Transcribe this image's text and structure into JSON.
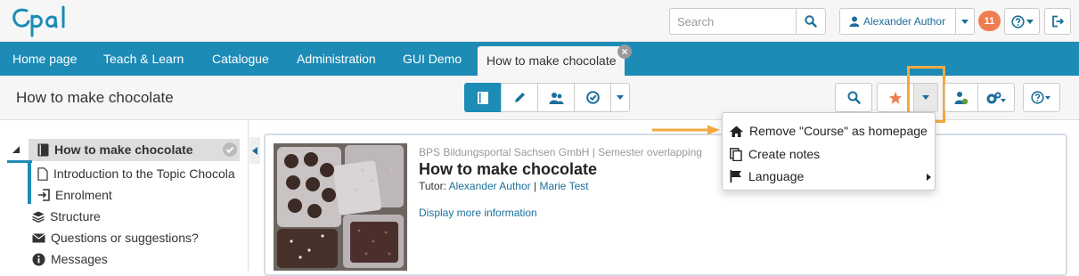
{
  "colors": {
    "brand": "#1c8bb6",
    "accent": "#f4a83f",
    "badge": "#f07d4f"
  },
  "header": {
    "logo_text": "Opal",
    "search": {
      "placeholder": "Search",
      "value": ""
    },
    "user_name": "Alexander Author",
    "notification_count": "11"
  },
  "nav": {
    "items": [
      {
        "label": "Home page",
        "icon": "none"
      },
      {
        "label": "Teach & Learn",
        "icon": "none"
      },
      {
        "label": "Catalogue",
        "icon": "none"
      },
      {
        "label": "Administration",
        "icon": "none"
      },
      {
        "label": "GUI Demo",
        "icon": "none"
      }
    ],
    "active_tab": {
      "label": "How to make chocolate",
      "close_icon": "close-icon"
    }
  },
  "toolbar": {
    "title": "How to make chocolate",
    "center_tools": [
      "book-icon",
      "pencil-icon",
      "users-icon",
      "check-circle-icon",
      "caret-down-icon"
    ],
    "right_tools": [
      "search-icon",
      "star-icon",
      "caret-down-icon",
      "user-settings-icon",
      "gears-icon",
      "help-icon"
    ]
  },
  "tree": {
    "root": {
      "label": "How to make chocolate",
      "icon": "book-icon",
      "status_icon": "check-icon"
    },
    "children": [
      {
        "label": "Introduction to the Topic Chocola",
        "icon": "page-icon"
      },
      {
        "label": "Enrolment",
        "icon": "enrol-icon"
      }
    ],
    "extras": [
      {
        "label": "Structure",
        "icon": "layers-icon"
      },
      {
        "label": "Questions or suggestions?",
        "icon": "envelope-icon"
      },
      {
        "label": "Messages",
        "icon": "info-icon"
      }
    ]
  },
  "course": {
    "meta": "BPS Bildungsportal Sachsen GmbH | Semester overlapping",
    "title": "How to make chocolate",
    "tutor_label": "Tutor:",
    "tutors": [
      "Alexander Author",
      "Marie Test"
    ],
    "separator": "|",
    "more_info": "Display more information"
  },
  "dropdown": {
    "items": [
      {
        "label": "Remove \"Course\" as homepage",
        "icon": "home-icon"
      },
      {
        "label": "Create notes",
        "icon": "notes-icon"
      },
      {
        "label": "Language",
        "icon": "flag-icon",
        "submenu": true
      }
    ]
  }
}
